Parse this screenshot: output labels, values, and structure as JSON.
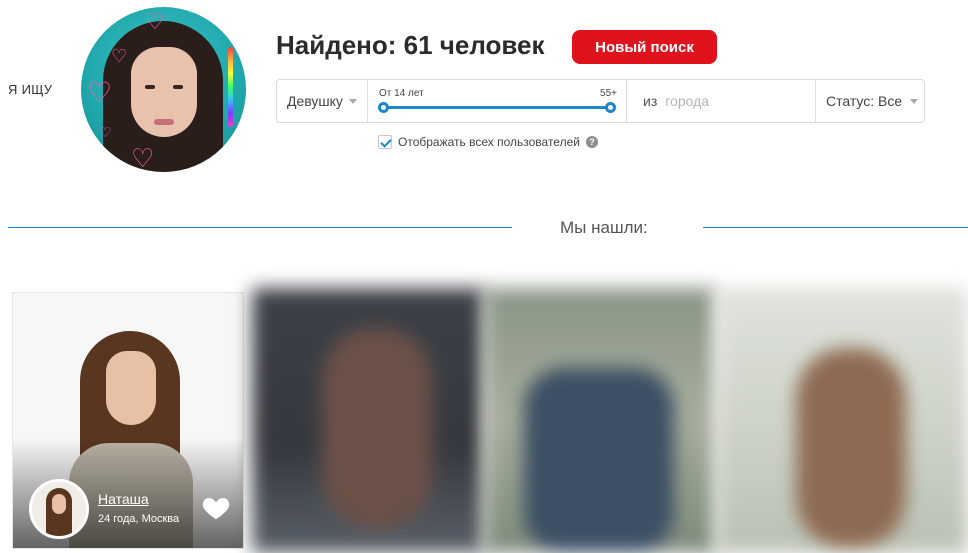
{
  "search_label": "Я ИЩУ",
  "header": {
    "found_title": "Найдено: 61 человек",
    "new_search_label": "Новый поиск"
  },
  "filters": {
    "gender": "Девушку",
    "age_from": "От 14 лет",
    "age_to": "55+",
    "age_range": [
      14,
      55
    ],
    "city_prefix": "из",
    "city_placeholder": "города",
    "status": "Статус: Все"
  },
  "options": {
    "show_all_label": "Отображать всех пользователей",
    "show_all_checked": true,
    "help_glyph": "?"
  },
  "results_label": "Мы нашли:",
  "results": [
    {
      "name": "Наташа",
      "meta": "24 года, Москва",
      "liked": false
    }
  ],
  "colors": {
    "accent": "#1a87c9",
    "button": "#e0121e",
    "text": "#2b2b2b"
  },
  "icons": {
    "like": "heart-icon",
    "help": "question-icon",
    "dropdown": "chevron-down-icon",
    "check": "check-icon"
  }
}
